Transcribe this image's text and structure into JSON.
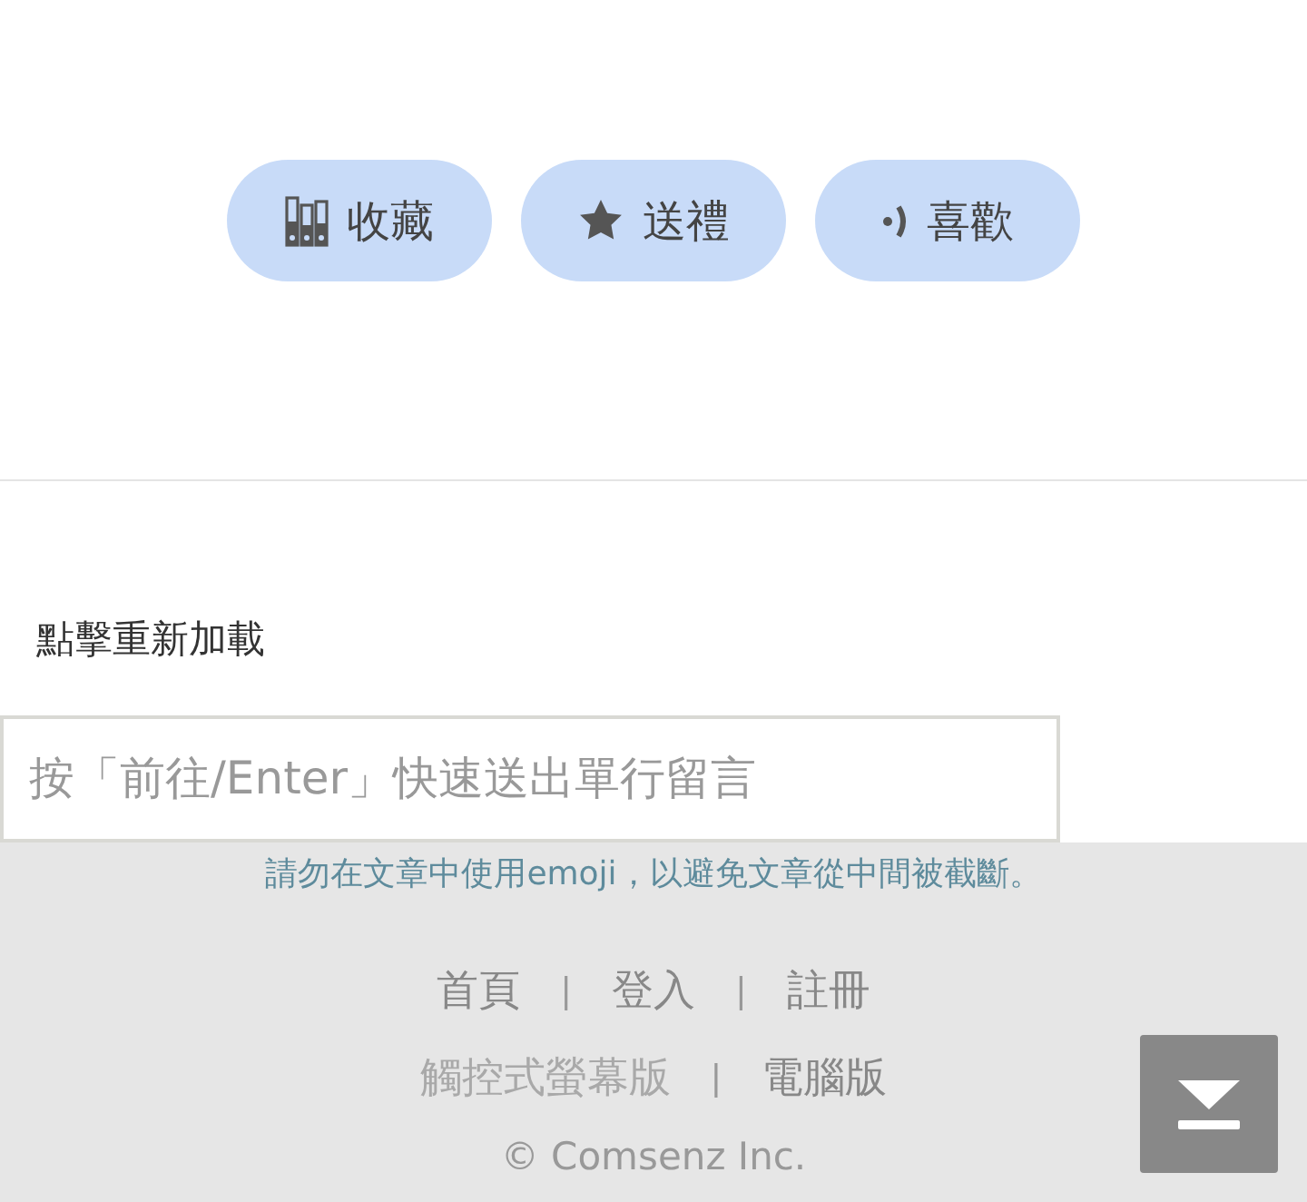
{
  "actions": [
    {
      "kind": "favorite",
      "label": "收藏"
    },
    {
      "kind": "gift",
      "label": "送禮"
    },
    {
      "kind": "like",
      "label": "喜歡"
    }
  ],
  "reload_link": "點擊重新加載",
  "comment": {
    "placeholder": "按「前往/Enter」快速送出單行留言"
  },
  "notice": "請勿在文章中使用emoji，以避免文章從中間被截斷。",
  "footer": {
    "rows": [
      {
        "items": [
          {
            "kind": "link",
            "text": "首頁",
            "current": false
          },
          {
            "kind": "separator",
            "text": "|"
          },
          {
            "kind": "link",
            "text": "登入",
            "current": false
          },
          {
            "kind": "separator",
            "text": "|"
          },
          {
            "kind": "link",
            "text": "註冊",
            "current": false
          }
        ]
      },
      {
        "items": [
          {
            "kind": "link",
            "text": "觸控式螢幕版",
            "current": true
          },
          {
            "kind": "separator",
            "text": "|"
          },
          {
            "kind": "link",
            "text": "電腦版",
            "current": false
          }
        ]
      }
    ],
    "copyright": "© Comsenz Inc."
  }
}
